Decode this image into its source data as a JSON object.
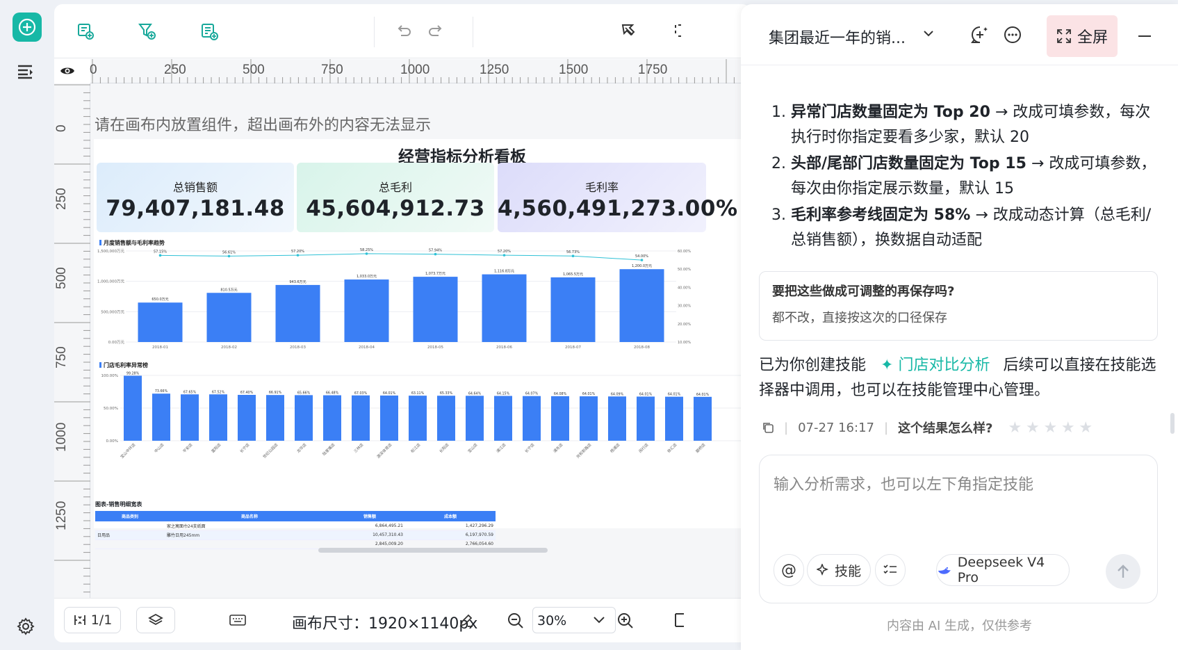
{
  "toolbar": {
    "page_indicator": "1/1",
    "canvas_size_label": "画布尺寸：1920×1140px",
    "zoom_value": "30%"
  },
  "ruler": {
    "h_labels": [
      "0",
      "250",
      "500",
      "750",
      "1000",
      "1250",
      "1500",
      "1750"
    ],
    "v_labels": [
      "0",
      "250",
      "500",
      "750",
      "1000",
      "1250"
    ]
  },
  "canvas": {
    "hint": "请在画布内放置组件，超出画布外的内容无法显示"
  },
  "dashboard": {
    "title": "经营指标分析看板",
    "kpis": [
      {
        "label": "总销售额",
        "value": "79,407,181.48",
        "bg": "#e6f1fc"
      },
      {
        "label": "总毛利",
        "value": "45,604,912.73",
        "bg": "#e5f7f0"
      },
      {
        "label": "毛利率",
        "value": "4,560,491,273.00%",
        "bg": "#e7e8fb"
      }
    ],
    "monthly_title": "月度销售额与毛利率趋势",
    "store_title": "门店毛利率异常榜",
    "table_title": "图表-销售明细宽表",
    "table": {
      "headers": [
        "商品类别",
        "商品名称",
        "销售额",
        "成本额"
      ],
      "rows": [
        [
          "",
          "家之寓面巾24支纸面",
          "6,864,495.21",
          "1,427,296.29"
        ],
        [
          "日用品",
          "雕竹日用245mm",
          "10,457,310.43",
          "6,197,970.59"
        ],
        [
          "",
          "",
          "2,845,009.20",
          "2,766,054.60"
        ]
      ]
    }
  },
  "chart_data": [
    {
      "type": "bar",
      "title": "月度销售额与毛利率趋势",
      "categories": [
        "2018-01",
        "2018-02",
        "2018-03",
        "2018-04",
        "2018-05",
        "2018-06",
        "2018-07",
        "2018-08"
      ],
      "series": [
        {
          "values": [
            650,
            810,
            940,
            1030,
            1075,
            1115,
            1065,
            1200
          ]
        },
        {
          "values": [
            57.1,
            56.6,
            57.2,
            58.2,
            57.9,
            57.2,
            56.7,
            54.0
          ]
        }
      ],
      "bar_labels": [
        "650.0万元",
        "810.5万元",
        "943.6万元",
        "1,033.0万元",
        "1,073.7万元",
        "1,116.8万元",
        "1,065.5万元",
        "1,200.0万元"
      ],
      "line_labels": [
        "57.15%",
        "56.61%",
        "57.20%",
        "58.25%",
        "57.94%",
        "57.20%",
        "56.73%",
        "54.00%"
      ],
      "yticks_left": [
        "1,500,000万元",
        "1,000,000万元",
        "500,000万元",
        "0.00万元"
      ],
      "yticks_right": [
        "60.00%",
        "50.00%",
        "40.00%",
        "30.00%",
        "20.00%",
        "10.00%"
      ],
      "ylim": [
        0,
        1500
      ],
      "color": "#3b7ff5"
    },
    {
      "type": "bar",
      "title": "门店毛利率异常榜",
      "categories": [
        "宝山中环店",
        "中山店",
        "平安店",
        "富阳店",
        "长宁店",
        "世纪公园店",
        "龙华店",
        "陆家嘴店",
        "三林店",
        "源深体育店",
        "松江店",
        "长阳店",
        "宝山店",
        "浦江店",
        "长宁店",
        "浦东店",
        "共和新路店",
        "杨浦店",
        "闵行店",
        "徐汇店",
        "颛桥店"
      ],
      "values": [
        99.5,
        72.1,
        71.0,
        71.0,
        70.2,
        70.0,
        69.8,
        69.6,
        69.4,
        69.2,
        69.0,
        68.9,
        68.8,
        68.6,
        68.4,
        68.2,
        68.0,
        67.8,
        67.6,
        67.4,
        67.2
      ],
      "value_labels": [
        "99.28%",
        "73.66%",
        "67.65%",
        "67.52%",
        "67.40%",
        "66.91%",
        "65.66%",
        "66.48%",
        "67.03%",
        "64.01%",
        "63.11%",
        "65.33%",
        "64.64%",
        "64.15%",
        "64.07%",
        "64.08%",
        "64.01%",
        "64.09%",
        "64.01%",
        "64.01%",
        "64.01%"
      ],
      "yticks": [
        "100.00%",
        "50.00%",
        "0.00%"
      ],
      "ylim": [
        0,
        100
      ],
      "color": "#3b7ff5"
    }
  ],
  "panel": {
    "session_title": "集团最近一年的销...",
    "fullscreen_label": "全屏",
    "messages": [
      {
        "b": "异常门店数量固定为 Top 20",
        "rest": " → 改成可填参数，每次执行时你指定要看多少家，默认 20"
      },
      {
        "b": "头部/尾部门店数量固定为 Top 15",
        "rest": " → 改成可填参数，每次由你指定展示数量，默认 15"
      },
      {
        "b": "毛利率参考线固定为 58%",
        "rest": " → 改成动态计算（总毛利/总销售额），换数据自动适配"
      }
    ],
    "question": "要把这些做成可调整的再保存吗?",
    "answer": "都不改，直接按这次的口径保存",
    "skill_prefix": "已为你创建技能",
    "skill_name": "门店对比分析",
    "skill_suffix": "后续可以直接在技能选择器中调用，也可以在技能管理中心管理。",
    "timestamp": "07-27 16:17",
    "feedback_q": "这个结果怎么样?",
    "input_placeholder": "输入分析需求，也可以左下角指定技能",
    "skill_btn": "技能",
    "model": "Deepseek V4 Pro",
    "disclaimer": "内容由 AI 生成，仅供参考"
  }
}
